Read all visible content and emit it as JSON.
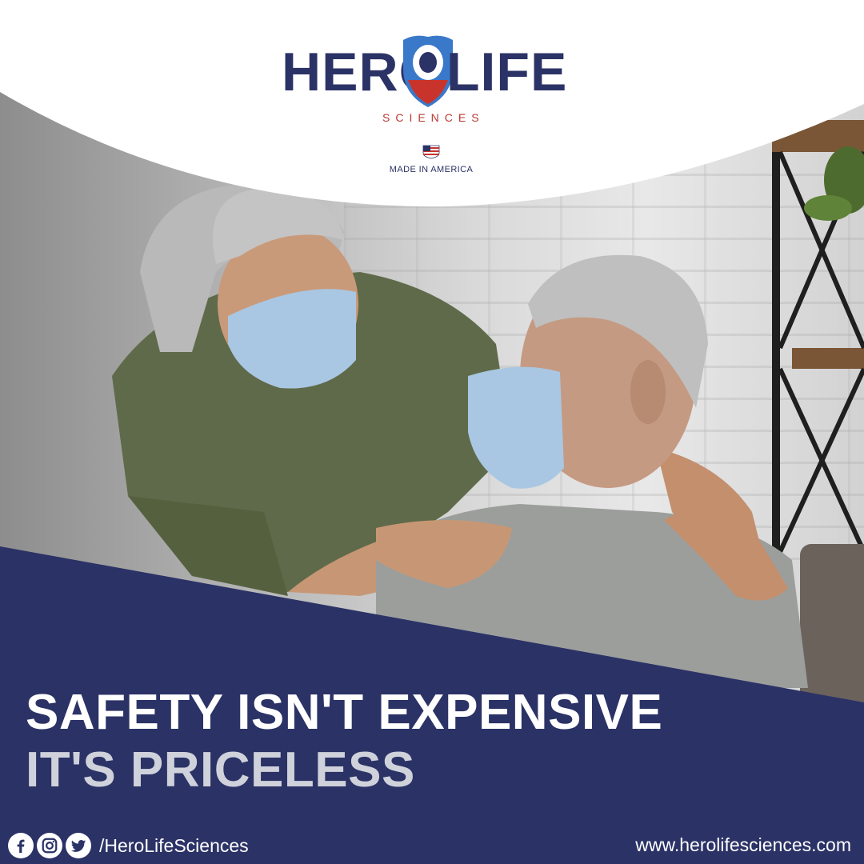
{
  "brand": {
    "name_left": "HERO",
    "name_right": "LIFE",
    "sub": "SCIENCES",
    "made_in": "MADE IN AMERICA"
  },
  "headline": {
    "line1": "SAFETY ISN'T EXPENSIVE",
    "line2": "IT'S PRICELESS"
  },
  "footer": {
    "social_handle": "/HeroLifeSciences",
    "website": "www.herolifesciences.com"
  },
  "colors": {
    "navy": "#2b3266",
    "red": "#b63a32",
    "shield_blue": "#3a78c9",
    "headline_light": "#cfd2db"
  },
  "icons": [
    "facebook-icon",
    "instagram-icon",
    "twitter-icon",
    "shield-logo-icon",
    "us-flag-icon"
  ]
}
